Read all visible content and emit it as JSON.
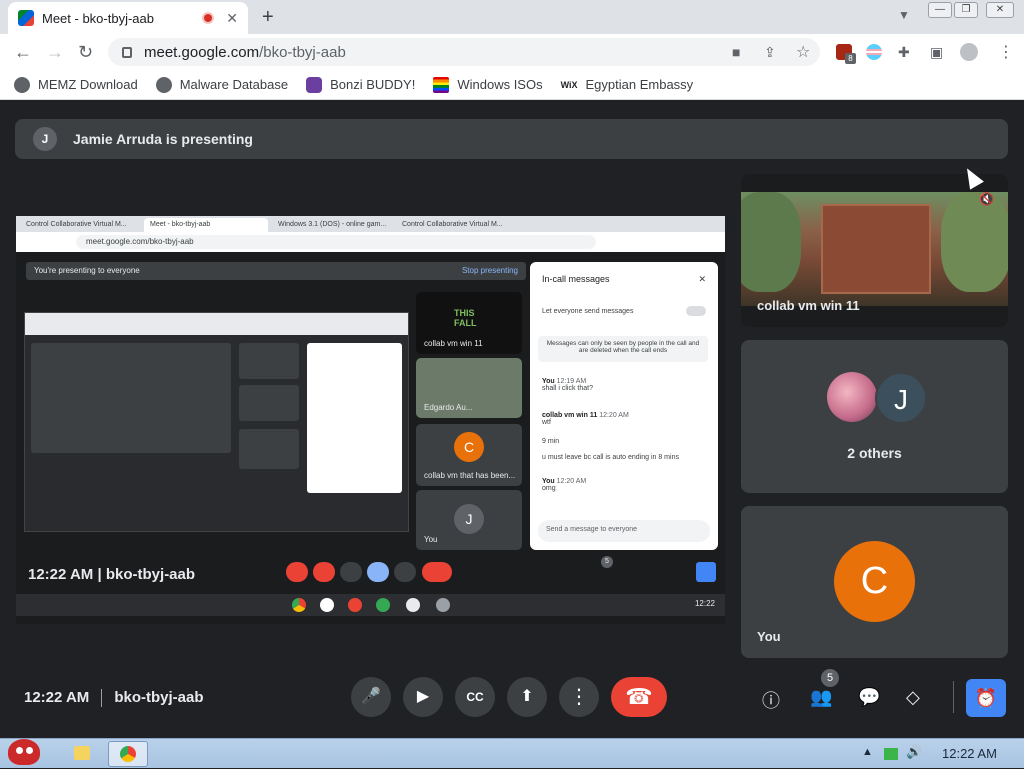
{
  "browser": {
    "tab_title": "Meet - bko-tbyj-aab",
    "tab_close": "✕",
    "new_tab": "+",
    "url_host": "meet.google.com",
    "url_path": "/bko-tbyj-aab",
    "ext_badge": "8",
    "bookmarks": [
      {
        "label": "MEMZ Download"
      },
      {
        "label": "Malware Database"
      },
      {
        "label": "Bonzi BUDDY!"
      },
      {
        "label": "Windows ISOs"
      },
      {
        "label": "Egyptian Embassy"
      }
    ]
  },
  "meet": {
    "presenter_avatar": "J",
    "presenting_text": "Jamie Arruda is presenting",
    "shared_screen": {
      "tabs": [
        "Control Collaborative Virtual M...",
        "Meet - bko-tbyj-aab",
        "Windows 3.1 (DOS) - online gam...",
        "Control Collaborative Virtual M..."
      ],
      "url": "meet.google.com/bko-tbyj-aab",
      "banner": "You're presenting to everyone",
      "stop": "Stop presenting",
      "chat": {
        "title": "In-call messages",
        "toggle_label": "Let everyone send messages",
        "note": "Messages can only be seen by people in the call and are deleted when the call ends",
        "messages": [
          {
            "who": "You",
            "time": "12:19 AM",
            "text": "shall i click that?"
          },
          {
            "who": "collab vm win 11",
            "time": "12:20 AM",
            "text": "wtf"
          },
          {
            "who": "",
            "time": "",
            "text": "9 min"
          },
          {
            "who": "",
            "time": "",
            "text": "u must leave bc call is auto ending in 8 mins"
          },
          {
            "who": "You",
            "time": "12:20 AM",
            "text": "omg"
          }
        ],
        "input_placeholder": "Send a message to everyone"
      },
      "tiles": [
        {
          "name": "collab vm win 11"
        },
        {
          "name": "Edgardo Au..."
        },
        {
          "name": "collab vm that has been..."
        },
        {
          "name": "You"
        }
      ],
      "tile_avatars": [
        "C",
        "J"
      ],
      "time": "12:22 AM",
      "code": "bko-tbyj-aab",
      "people_badge": "5",
      "clock": "12:22"
    },
    "tiles": {
      "vm_name": "collab vm win 11",
      "others_initial": "J",
      "others_label": "2 others",
      "you_initial": "C",
      "you_label": "You"
    },
    "bottom": {
      "time": "12:22 AM",
      "code": "bko-tbyj-aab",
      "people_count": "5"
    }
  },
  "taskbar": {
    "clock": "12:22 AM"
  },
  "colors": {
    "meet_bg": "#202124",
    "tile_bg": "#3c4043",
    "end_call": "#ea4335",
    "accent_blue": "#4285f4",
    "avatar_orange": "#e8710a"
  }
}
